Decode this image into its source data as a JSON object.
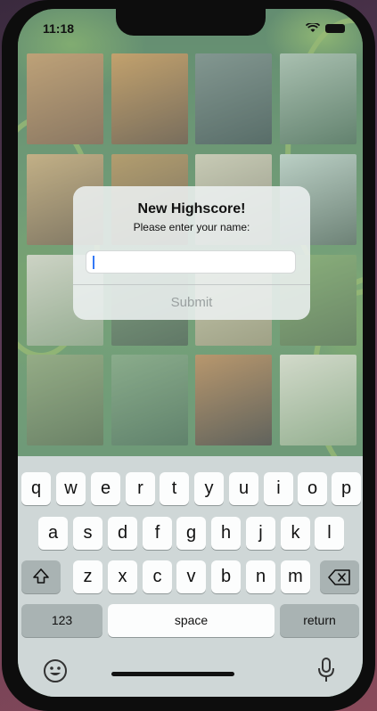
{
  "status": {
    "time": "11:18"
  },
  "dialog": {
    "title": "New Highscore!",
    "message": "Please enter your name:",
    "input_value": "",
    "submit_label": "Submit"
  },
  "keyboard": {
    "row1": [
      "q",
      "w",
      "e",
      "r",
      "t",
      "y",
      "u",
      "i",
      "o",
      "p"
    ],
    "row2": [
      "a",
      "s",
      "d",
      "f",
      "g",
      "h",
      "j",
      "k",
      "l"
    ],
    "row3": [
      "z",
      "x",
      "c",
      "v",
      "b",
      "n",
      "m"
    ],
    "numbers_label": "123",
    "space_label": "space",
    "return_label": "return",
    "shift_icon": "shift-icon",
    "delete_icon": "delete-icon",
    "emoji_icon": "emoji-icon",
    "mic_icon": "microphone-icon"
  },
  "background": {
    "tiles": [
      "lion",
      "tiger",
      "gorilla",
      "panda",
      "lion",
      "tiger",
      "zebra",
      "panda",
      "dog",
      "horse",
      "dog",
      "horse",
      "lion",
      "horse",
      "tiger",
      "dog"
    ]
  },
  "colors": {
    "accent": "#3478f6",
    "keyboard_bg": "#cfd7d7",
    "key_bg": "#fcfdfd",
    "dark_key_bg": "#a9b3b3"
  }
}
